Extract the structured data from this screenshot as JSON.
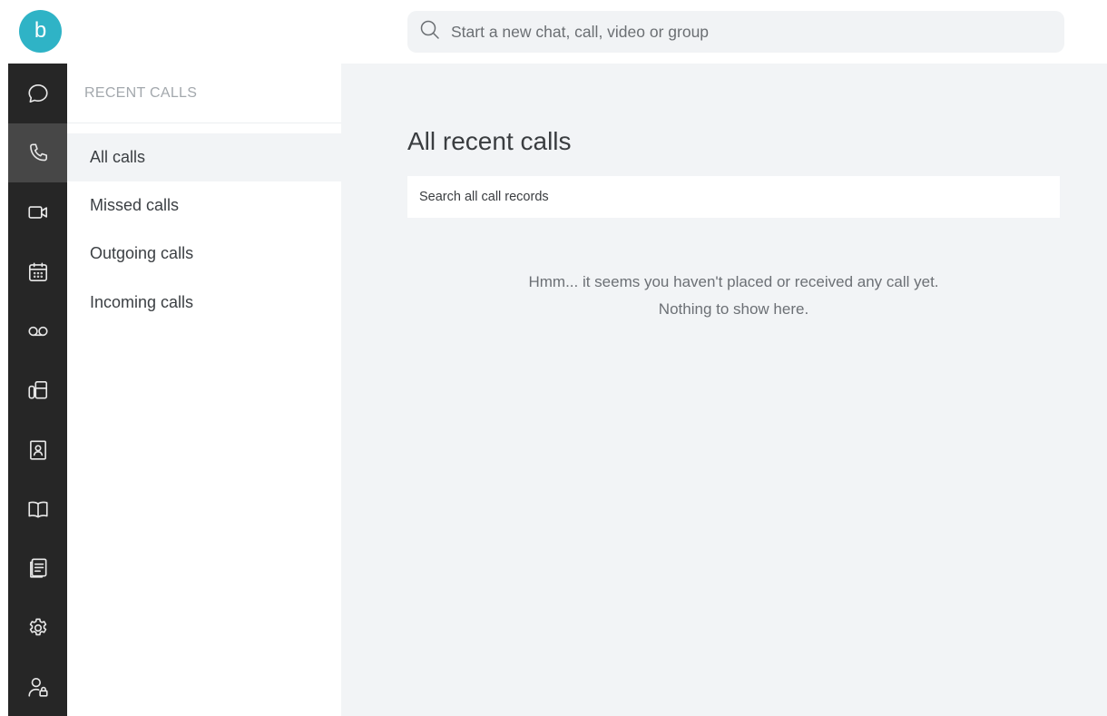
{
  "app": {
    "logo_letter": "b",
    "brand_color": "#2fb3c6",
    "rail_color": "#262626",
    "rail_active_color": "#474747"
  },
  "search": {
    "placeholder": "Start a new chat, call, video or group",
    "icon": "search-icon"
  },
  "rail": {
    "items": [
      {
        "icon": "chat-bubble-icon",
        "active": false
      },
      {
        "icon": "phone-icon",
        "active": true
      },
      {
        "icon": "video-camera-icon",
        "active": false
      },
      {
        "icon": "calendar-icon",
        "active": false
      },
      {
        "icon": "voicemail-icon",
        "active": false
      },
      {
        "icon": "fax-icon",
        "active": false
      },
      {
        "icon": "contact-card-icon",
        "active": false
      },
      {
        "icon": "book-icon",
        "active": false
      },
      {
        "icon": "notes-icon",
        "active": false
      },
      {
        "icon": "gear-icon",
        "active": false
      },
      {
        "icon": "user-lock-icon",
        "active": false
      }
    ]
  },
  "subnav": {
    "title": "RECENT CALLS",
    "items": [
      {
        "label": "All calls",
        "active": true
      },
      {
        "label": "Missed calls",
        "active": false
      },
      {
        "label": "Outgoing calls",
        "active": false
      },
      {
        "label": "Incoming calls",
        "active": false
      }
    ]
  },
  "main": {
    "title": "All recent calls",
    "search_placeholder": "Search all call records",
    "empty_line1": "Hmm... it seems you haven't placed or received any call yet.",
    "empty_line2": "Nothing to show here."
  }
}
